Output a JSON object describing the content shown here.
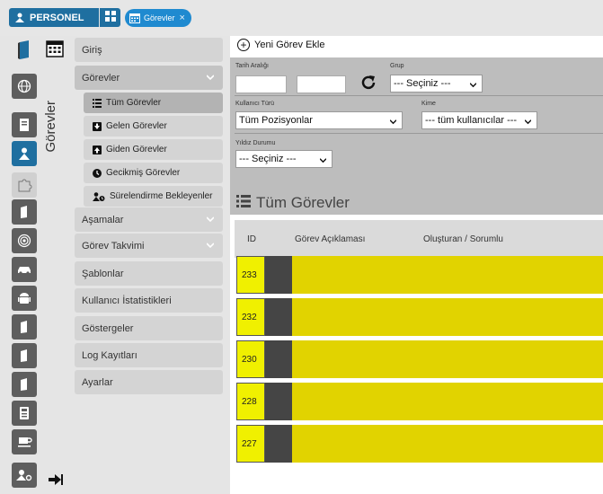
{
  "topbar": {
    "brand_label": "PERSONEL",
    "tab_label": "Görevler",
    "tab_close": "×"
  },
  "sidebar": {
    "vertical_title": "Görevler",
    "rail_icons": [
      "book-icon",
      "globe-icon",
      "notebook-icon",
      "user-icon",
      "puzzle-icon",
      "file-icon",
      "target-icon",
      "car-icon",
      "android-icon",
      "file-icon",
      "file-icon",
      "file-icon",
      "calculator-icon",
      "coffee-icon",
      "user-settings-icon"
    ],
    "logout_icon": "sign-out-icon"
  },
  "menu": {
    "items": [
      {
        "label": "Giriş"
      },
      {
        "label": "Görevler",
        "open": true
      },
      {
        "label": "Aşamalar",
        "chevron": true
      },
      {
        "label": "Görev Takvimi",
        "chevron": true
      },
      {
        "label": "Şablonlar"
      },
      {
        "label": "Kullanıcı İstatistikleri"
      },
      {
        "label": "Göstergeler"
      },
      {
        "label": "Log Kayıtları"
      },
      {
        "label": "Ayarlar"
      }
    ],
    "subitems": [
      {
        "label": "Tüm Görevler",
        "icon": "list-icon",
        "active": true
      },
      {
        "label": "Gelen Görevler",
        "icon": "arrow-down-icon"
      },
      {
        "label": "Giden Görevler",
        "icon": "arrow-up-icon"
      },
      {
        "label": "Gecikmiş Görevler",
        "icon": "clock-icon"
      },
      {
        "label": "Sürelendirme Bekleyenler",
        "icon": "user-clock-icon"
      }
    ]
  },
  "main": {
    "new_task_label": "Yeni Görev Ekle",
    "filters": {
      "date_range_label": "Tarih Aralığı",
      "date_from": "",
      "date_to": "",
      "group_label": "Grup",
      "group_value": "--- Seçiniz ---",
      "user_type_label": "Kullanıcı Türü",
      "user_type_value": "Tüm Pozisyonlar",
      "to_whom_label": "Kime",
      "to_whom_value": "--- tüm kullanıcılar ---",
      "star_status_label": "Yıldız Durumu",
      "star_status_value": "--- Seçiniz ---"
    },
    "section_title": "Tüm Görevler",
    "table": {
      "columns": [
        "ID",
        "Görev Açıklaması",
        "Oluşturan / Sorumlu"
      ],
      "rows": [
        {
          "id": "233"
        },
        {
          "id": "232"
        },
        {
          "id": "230"
        },
        {
          "id": "228"
        },
        {
          "id": "227"
        }
      ]
    }
  },
  "colors": {
    "brand": "#1f6fa0",
    "tab_pill": "#1f8ad0",
    "row_highlight": "#e1d300",
    "id_cell": "#f0f000",
    "rail_dark": "#5e5e5e"
  }
}
